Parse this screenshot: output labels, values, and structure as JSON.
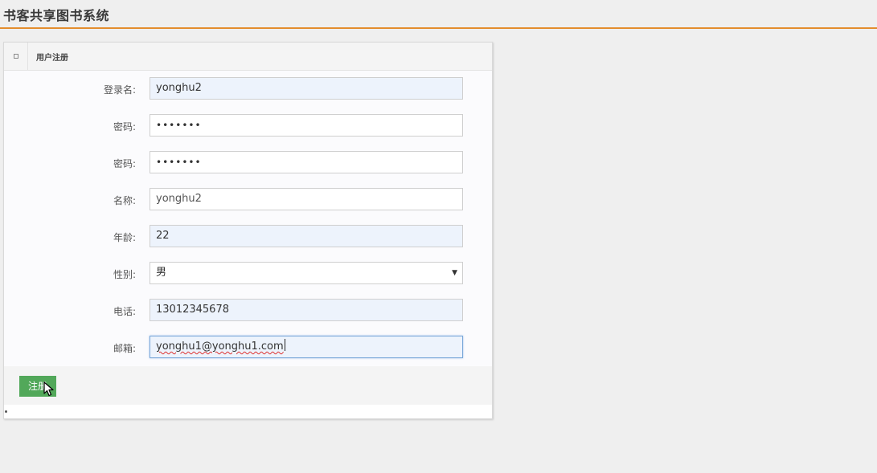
{
  "app": {
    "title": "书客共享图书系统"
  },
  "panel": {
    "title": "用户注册",
    "collapse_icon": "collapse-icon"
  },
  "form": {
    "username": {
      "label": "登录名:",
      "value": "yonghu2"
    },
    "password": {
      "label": "密码:",
      "value": "•••••••"
    },
    "password_confirm": {
      "label": "密码:",
      "value": "•••••••"
    },
    "name": {
      "label": "名称:",
      "value": "yonghu2"
    },
    "age": {
      "label": "年龄:",
      "value": "22"
    },
    "gender": {
      "label": "性别:",
      "value": "男",
      "arrow": "▼"
    },
    "phone": {
      "label": "电话:",
      "value": "13012345678"
    },
    "email": {
      "label": "邮箱:",
      "value": "yonghu1@yonghu1.com"
    }
  },
  "actions": {
    "submit_label": "注册"
  },
  "colors": {
    "accent_line": "#e38d2d",
    "submit_button": "#52a85a",
    "autofill_bg": "#edf3fc"
  }
}
